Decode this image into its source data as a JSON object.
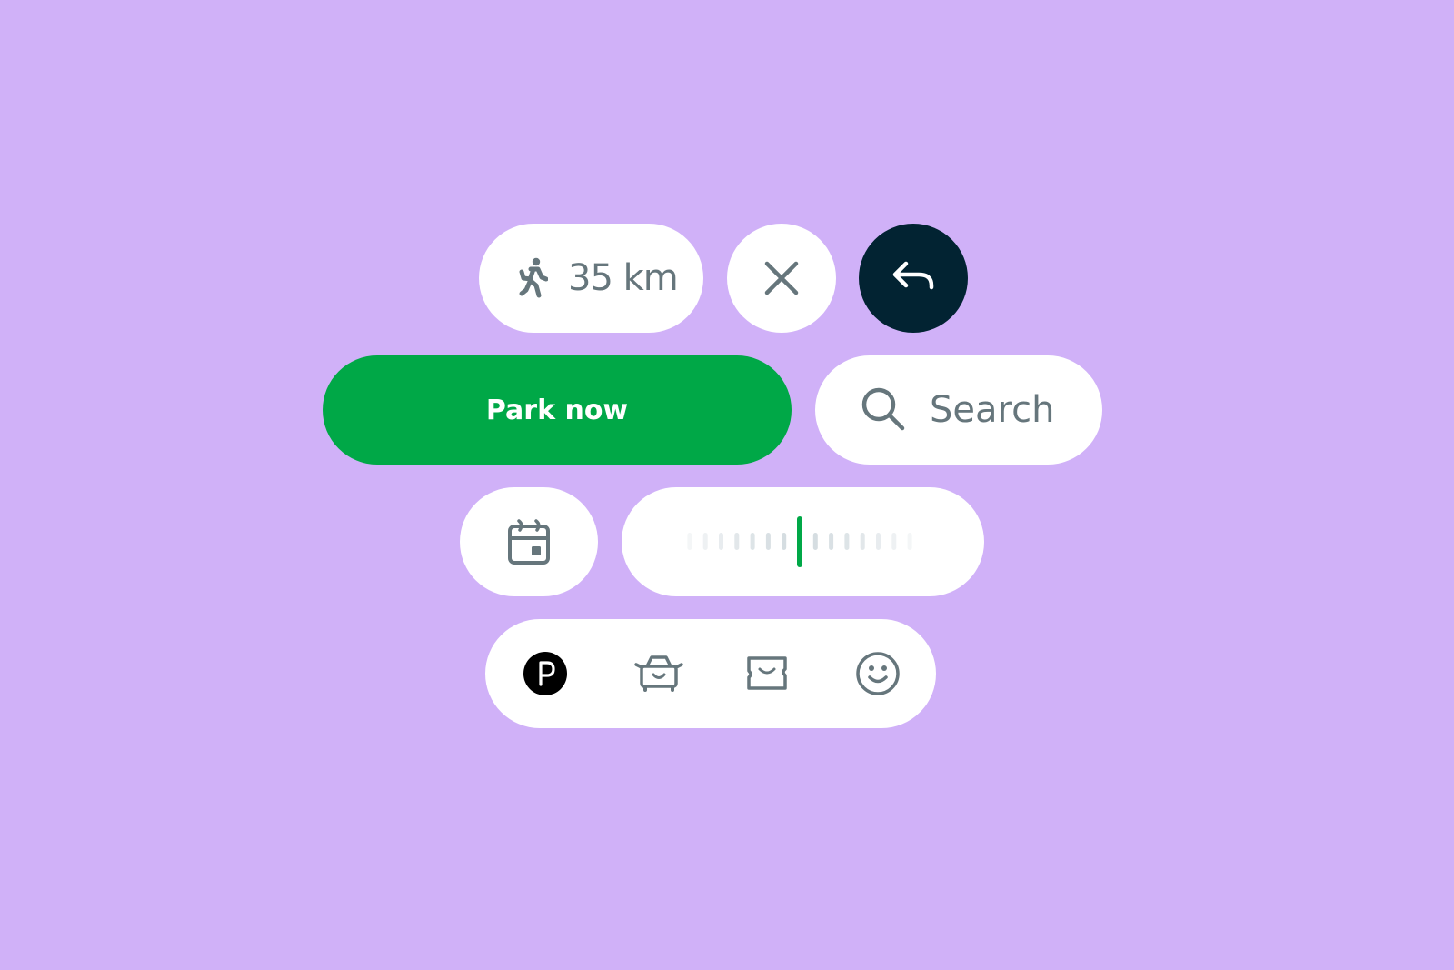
{
  "colors": {
    "background": "#d0b1f8",
    "surface": "#ffffff",
    "icon_gray": "#66767c",
    "primary_green": "#00a847",
    "dark_navy": "#022332",
    "tick_gray": "#d5dde1"
  },
  "distance_chip": {
    "icon": "walking-person-icon",
    "label": "35 km"
  },
  "close_button": {
    "icon": "close-icon"
  },
  "back_button": {
    "icon": "undo-arrow-icon"
  },
  "park_button": {
    "label": "Park now"
  },
  "search_field": {
    "icon": "search-icon",
    "placeholder": "Search"
  },
  "calendar_button": {
    "icon": "calendar-icon"
  },
  "time_slider": {
    "ticks_left": 7,
    "ticks_right": 7,
    "selected_position": 0.5
  },
  "bottom_nav": {
    "items": [
      {
        "name": "parking",
        "icon": "parking-icon",
        "active": true
      },
      {
        "name": "vehicles",
        "icon": "car-icon",
        "active": false
      },
      {
        "name": "tickets",
        "icon": "ticket-icon",
        "active": false
      },
      {
        "name": "profile",
        "icon": "smiley-icon",
        "active": false
      }
    ]
  }
}
